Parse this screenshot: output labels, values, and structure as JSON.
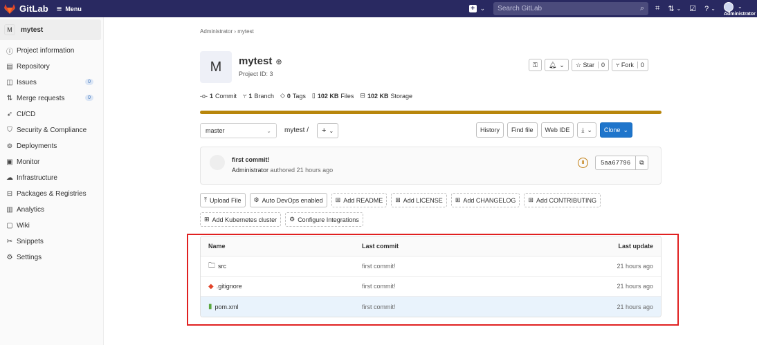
{
  "topbar": {
    "app_name": "GitLab",
    "menu_label": "Menu",
    "search_placeholder": "Search GitLab",
    "user_name": "Administrator"
  },
  "sidebar": {
    "project_initial": "M",
    "project_name": "mytest",
    "items": [
      {
        "label": "Project information",
        "icon": "info-icon"
      },
      {
        "label": "Repository",
        "icon": "book-icon"
      },
      {
        "label": "Issues",
        "icon": "issues-icon",
        "badge": "0"
      },
      {
        "label": "Merge requests",
        "icon": "merge-request-icon",
        "badge": "0"
      },
      {
        "label": "CI/CD",
        "icon": "rocket-icon"
      },
      {
        "label": "Security & Compliance",
        "icon": "shield-icon"
      },
      {
        "label": "Deployments",
        "icon": "deployments-icon"
      },
      {
        "label": "Monitor",
        "icon": "monitor-icon"
      },
      {
        "label": "Infrastructure",
        "icon": "cloud-icon"
      },
      {
        "label": "Packages & Registries",
        "icon": "package-icon"
      },
      {
        "label": "Analytics",
        "icon": "chart-icon"
      },
      {
        "label": "Wiki",
        "icon": "wiki-icon"
      },
      {
        "label": "Snippets",
        "icon": "scissors-icon"
      },
      {
        "label": "Settings",
        "icon": "gear-icon"
      }
    ]
  },
  "breadcrumb": {
    "root": "Administrator",
    "sep": "›",
    "current": "mytest"
  },
  "project": {
    "initial": "M",
    "title": "mytest",
    "id_label": "Project ID: 3",
    "star_label": "Star",
    "star_count": "0",
    "fork_label": "Fork",
    "fork_count": "0"
  },
  "stats": {
    "commits_count": "1",
    "commits_label": "Commit",
    "branches_count": "1",
    "branches_label": "Branch",
    "tags_count": "0",
    "tags_label": "Tags",
    "files_size": "102 KB",
    "files_label": "Files",
    "storage_size": "102 KB",
    "storage_label": "Storage"
  },
  "language_bar_color": "#b8860b",
  "toolbar": {
    "branch": "master",
    "path": "mytest",
    "path_sep": "/",
    "history": "History",
    "find_file": "Find file",
    "web_ide": "Web IDE",
    "clone": "Clone"
  },
  "last_commit": {
    "title": "first commit!",
    "author": "Administrator",
    "meta": "authored 21 hours ago",
    "sha": "5aa67796"
  },
  "quick_actions": [
    {
      "label": "Upload File",
      "icon": "upload-icon",
      "style": "solid"
    },
    {
      "label": "Auto DevOps enabled",
      "icon": "gear-icon",
      "style": "solid"
    },
    {
      "label": "Add README",
      "icon": "plus-square-icon",
      "style": "dashed"
    },
    {
      "label": "Add LICENSE",
      "icon": "plus-square-icon",
      "style": "dashed"
    },
    {
      "label": "Add CHANGELOG",
      "icon": "plus-square-icon",
      "style": "dashed"
    },
    {
      "label": "Add CONTRIBUTING",
      "icon": "plus-square-icon",
      "style": "dashed"
    },
    {
      "label": "Add Kubernetes cluster",
      "icon": "plus-square-icon",
      "style": "dashed"
    },
    {
      "label": "Configure Integrations",
      "icon": "gear-icon",
      "style": "dashed"
    }
  ],
  "files": {
    "headers": {
      "name": "Name",
      "last_commit": "Last commit",
      "last_update": "Last update"
    },
    "rows": [
      {
        "name": "src",
        "type": "folder",
        "commit": "first commit!",
        "updated": "21 hours ago"
      },
      {
        "name": ".gitignore",
        "type": "git",
        "commit": "first commit!",
        "updated": "21 hours ago"
      },
      {
        "name": "pom.xml",
        "type": "file",
        "commit": "first commit!",
        "updated": "21 hours ago"
      }
    ]
  },
  "highlight_color": "#e02020"
}
